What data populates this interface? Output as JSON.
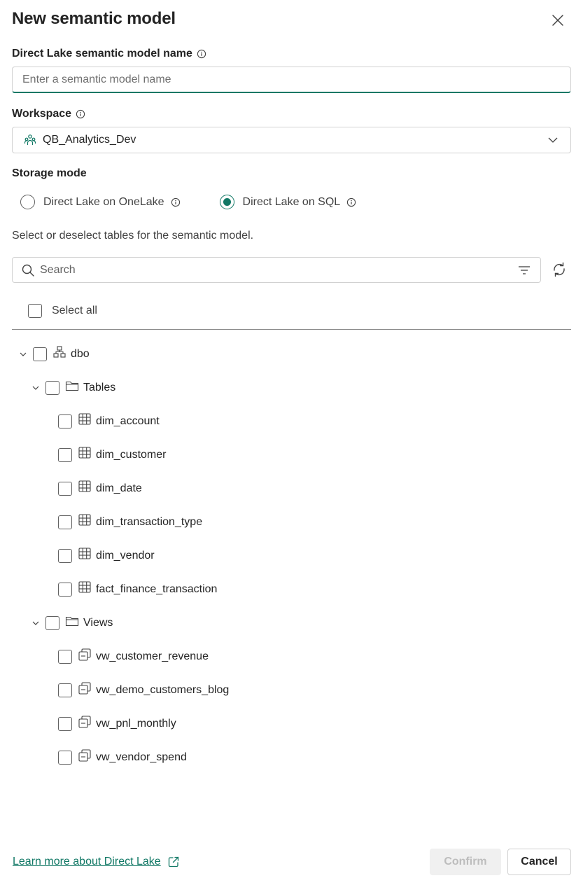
{
  "dialog": {
    "title": "New semantic model",
    "close_icon": "close-icon"
  },
  "name_field": {
    "label": "Direct Lake semantic model name",
    "placeholder": "Enter a semantic model name",
    "value": ""
  },
  "workspace": {
    "label": "Workspace",
    "value": "QB_Analytics_Dev",
    "icon": "workspace-icon"
  },
  "storage": {
    "label": "Storage mode",
    "options": [
      {
        "label": "Direct Lake on OneLake",
        "selected": false
      },
      {
        "label": "Direct Lake on SQL",
        "selected": true
      }
    ]
  },
  "tables": {
    "helper": "Select or deselect tables for the semantic model.",
    "search_placeholder": "Search",
    "select_all_label": "Select all",
    "schema": "dbo",
    "folders": [
      {
        "label": "Tables",
        "items": [
          "dim_account",
          "dim_customer",
          "dim_date",
          "dim_transaction_type",
          "dim_vendor",
          "fact_finance_transaction"
        ]
      },
      {
        "label": "Views",
        "items": [
          "vw_customer_revenue",
          "vw_demo_customers_blog",
          "vw_pnl_monthly",
          "vw_vendor_spend"
        ]
      }
    ]
  },
  "footer": {
    "learn_more": "Learn more about Direct Lake",
    "confirm": "Confirm",
    "cancel": "Cancel"
  },
  "colors": {
    "accent": "#117865",
    "disabled_bg": "#f0f0f0",
    "disabled_text": "#bdbdbd"
  }
}
